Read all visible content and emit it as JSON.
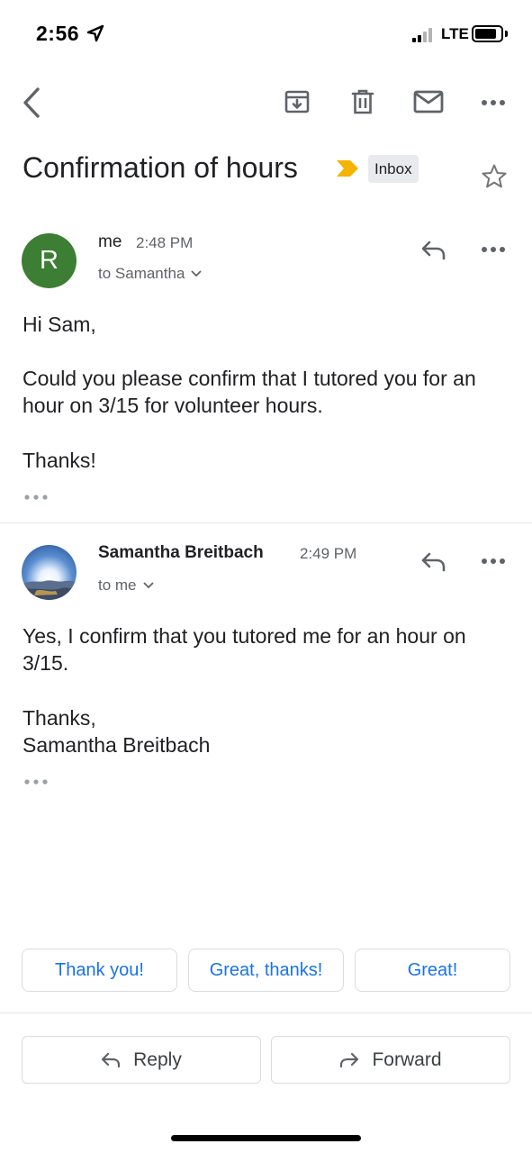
{
  "status_bar": {
    "time": "2:56",
    "network": "LTE",
    "signal_bars_filled": 2,
    "signal_bars_total": 4,
    "battery_level": 0.85
  },
  "toolbar": {
    "icons": [
      "back-arrow-icon",
      "archive-icon",
      "delete-icon",
      "mark-unread-icon",
      "more-vert-icon"
    ]
  },
  "email": {
    "subject": "Confirmation of hours",
    "label": "Inbox",
    "importance_color": "#f4b400"
  },
  "messages": [
    {
      "sender": "me",
      "avatar_letter": "R",
      "avatar_color": "#3c7e33",
      "time": "2:48 PM",
      "recipient": "to Samantha",
      "body": [
        "Hi Sam,",
        "Could you please confirm that I tutored you for an hour on 3/15 for volunteer hours.",
        "Thanks!"
      ]
    },
    {
      "sender": "Samantha Breitbach",
      "time": "2:49 PM",
      "recipient": "to me",
      "body": [
        "Yes, I confirm that you tutored me for an hour on 3/15.",
        "Thanks,",
        "Samantha Breitbach"
      ]
    }
  ],
  "smart_replies": [
    "Thank you!",
    "Great, thanks!",
    "Great!"
  ],
  "actions": {
    "reply": "Reply",
    "forward": "Forward"
  },
  "colors": {
    "accent": "#1a73e8",
    "label_chip_bg": "#e8eaed"
  }
}
